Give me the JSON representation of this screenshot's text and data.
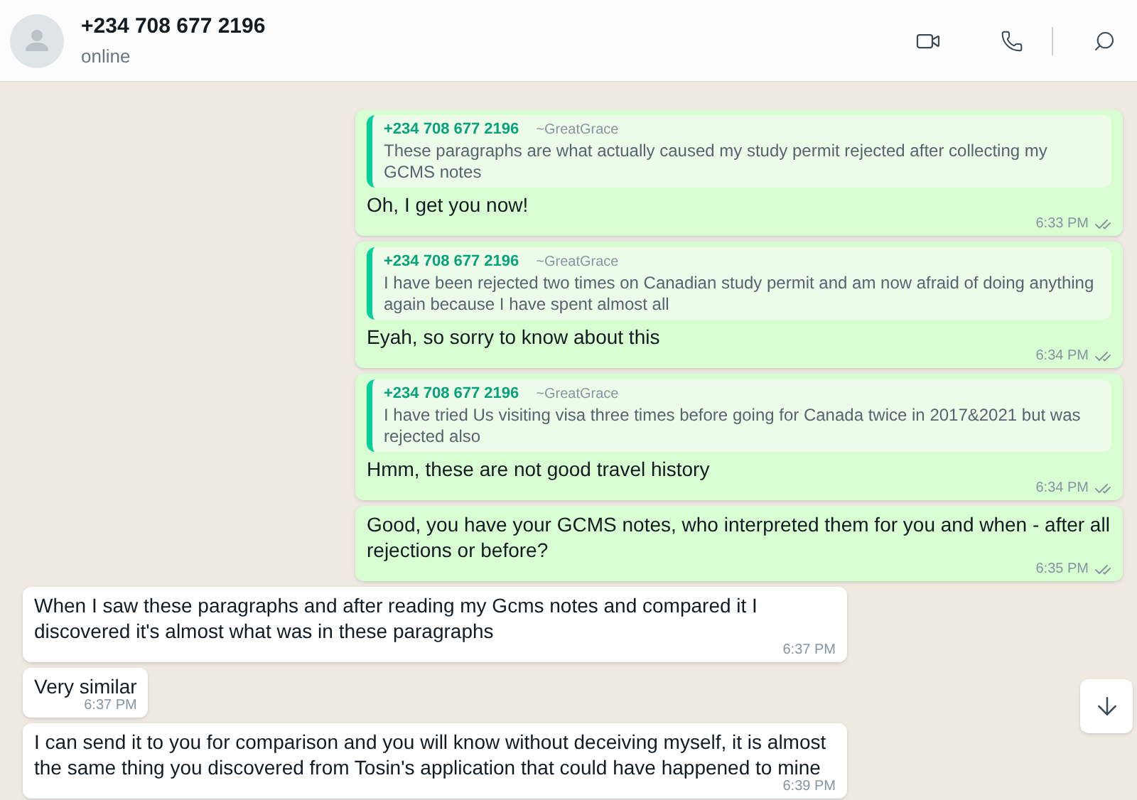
{
  "header": {
    "name": "+234 708 677 2196",
    "status": "online"
  },
  "messages": [
    {
      "kind": "out",
      "quote": {
        "sender": "+234 708 677 2196",
        "author": "~GreatGrace",
        "text": "These paragraphs are what actually caused my study permit rejected after collecting my GCMS notes"
      },
      "text": "Oh, I get you now!",
      "time": "6:33 PM"
    },
    {
      "kind": "out",
      "quote": {
        "sender": "+234 708 677 2196",
        "author": "~GreatGrace",
        "text": "I have been rejected two times on Canadian study permit and am now afraid of doing anything again because I have spent almost all"
      },
      "text": "Eyah, so sorry to know about this",
      "time": "6:34 PM"
    },
    {
      "kind": "out",
      "quote": {
        "sender": "+234 708 677 2196",
        "author": "~GreatGrace",
        "text": "I have tried Us visiting visa three times before going for Canada twice in 2017&2021 but was rejected also"
      },
      "text": "Hmm, these are not good travel history",
      "time": "6:34 PM"
    },
    {
      "kind": "out",
      "text": "Good, you have your GCMS notes, who interpreted them for you and when - after all rejections or before?",
      "time": "6:35 PM"
    },
    {
      "kind": "in",
      "text": "When I saw these paragraphs and after reading my Gcms notes and compared it I discovered it's almost what was in these paragraphs",
      "time": "6:37 PM"
    },
    {
      "kind": "in",
      "text": "Very similar",
      "time": "6:37 PM"
    },
    {
      "kind": "in",
      "text": "I can send it to you for comparison and you will know without deceiving myself, it is almost the same thing you discovered from Tosin's application that could have happened to mine",
      "time": "6:39 PM"
    }
  ]
}
